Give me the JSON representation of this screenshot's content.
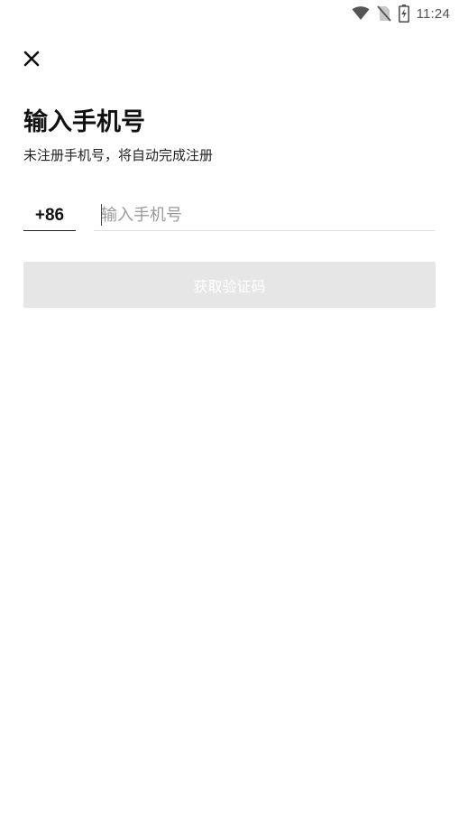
{
  "status_bar": {
    "time": "11:24",
    "icons": [
      "wifi-icon",
      "no-sim-icon",
      "battery-charging-icon"
    ]
  },
  "header": {
    "close_icon": "close-icon"
  },
  "main": {
    "title": "输入手机号",
    "subtitle": "未注册手机号，将自动完成注册",
    "country_code": "+86",
    "phone_input": {
      "value": "",
      "placeholder": "输入手机号"
    },
    "get_code_button": "获取验证码"
  },
  "colors": {
    "button_disabled_bg": "#e6e6e6",
    "placeholder": "#9a9a9a",
    "input_underline": "#e2e2e2",
    "text_primary": "#111111"
  }
}
